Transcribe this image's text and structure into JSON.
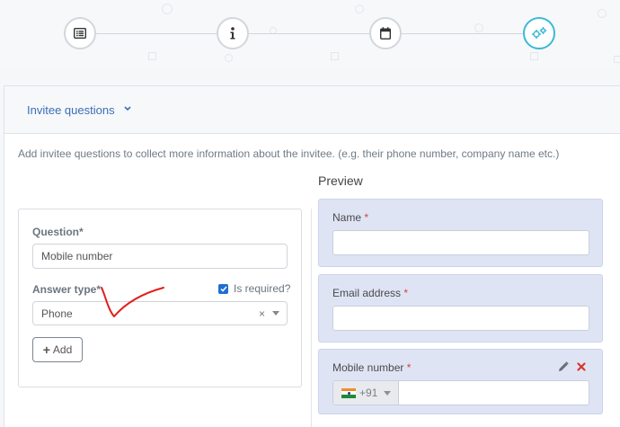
{
  "stepper": {
    "steps": [
      {
        "icon": "list-icon",
        "active": false
      },
      {
        "icon": "info-icon",
        "active": false
      },
      {
        "icon": "calendar-icon",
        "active": false
      },
      {
        "icon": "gears-icon",
        "active": true
      }
    ],
    "accent_color": "#3bb9d6"
  },
  "section": {
    "title": "Invitee questions",
    "description": "Add invitee questions to collect more information about the invitee. (e.g. their phone number, company name etc.)"
  },
  "form": {
    "question_label": "Question*",
    "question_value": "Mobile number",
    "answer_type_label": "Answer type*",
    "is_required_label": "Is required?",
    "is_required_checked": true,
    "answer_type_value": "Phone",
    "clear_symbol": "×",
    "add_label": "Add"
  },
  "preview": {
    "title": "Preview",
    "fields": [
      {
        "label": "Name",
        "required_mark": "*"
      },
      {
        "label": "Email address",
        "required_mark": "*"
      },
      {
        "label": "Mobile number",
        "required_mark": "*",
        "country_code": "+91"
      }
    ]
  }
}
